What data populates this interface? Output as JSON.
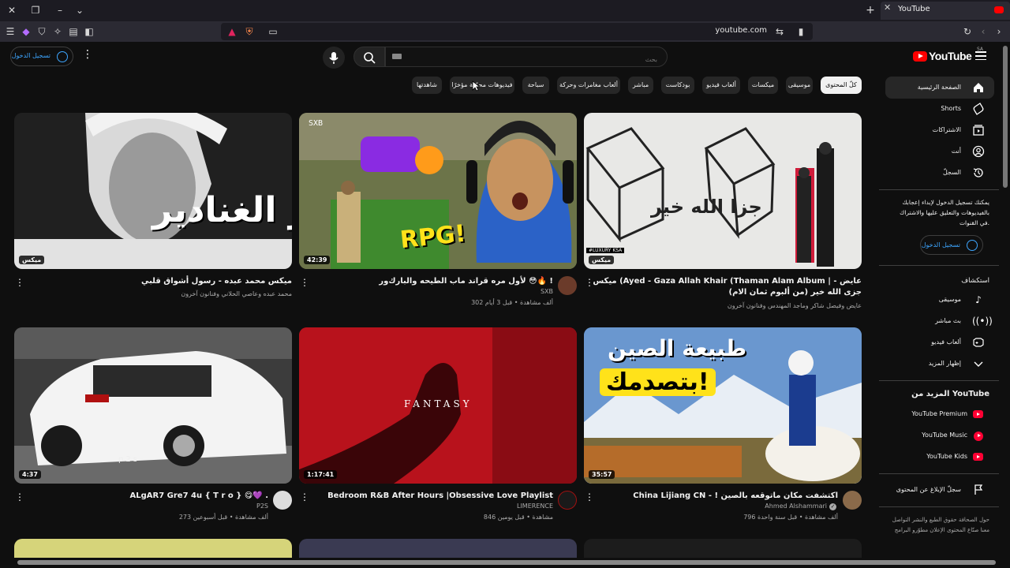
{
  "browser": {
    "tab_title": "YouTube",
    "url": "youtube.com"
  },
  "masthead": {
    "signin_label": "تسجيل الدخول",
    "search_placeholder": "بحث",
    "logo_text": "YouTube",
    "logo_country": "SA"
  },
  "chips": [
    {
      "label": "كلّ المحتوى",
      "active": true
    },
    {
      "label": "موسيقى"
    },
    {
      "label": "ميكسات"
    },
    {
      "label": "ألعاب فيديو"
    },
    {
      "label": "بودكاست"
    },
    {
      "label": "مباشر"
    },
    {
      "label": "ألعاب مغامرات وحركة"
    },
    {
      "label": "سباحة"
    },
    {
      "label": "فيديوهات محمّلة مؤخرًا"
    },
    {
      "label": "شاهدتها"
    }
  ],
  "guide": {
    "main": [
      {
        "label": "الصفحة الرئيسية",
        "icon": "home-icon"
      },
      {
        "label": "Shorts",
        "icon": "shorts-icon"
      },
      {
        "label": "الاشتراكات",
        "icon": "subscriptions-icon"
      },
      {
        "label": "أنت",
        "icon": "you-icon"
      },
      {
        "label": "السجلّ",
        "icon": "history-icon"
      }
    ],
    "signin_prompt": "يمكنك تسجيل الدخول لإبداء إعجابك بالفيديوهات والتعليق عليها والاشتراك في القنوات.",
    "signin_label": "تسجيل الدخول",
    "explore_heading": "استكشاف",
    "explore": [
      {
        "label": "موسيقى",
        "icon": "music-icon"
      },
      {
        "label": "بث مباشر",
        "icon": "live-icon"
      },
      {
        "label": "ألعاب فيديو",
        "icon": "gaming-icon"
      },
      {
        "label": "إظهار المزيد",
        "icon": "chevron-down-icon"
      }
    ],
    "more_heading": "المزيد من YouTube",
    "more": [
      {
        "label": "YouTube Premium"
      },
      {
        "label": "YouTube Music"
      },
      {
        "label": "YouTube Kids"
      }
    ],
    "report_label": "سجلّ الإبلاغ عن المحتوى",
    "footer": "حول  الصحافة  حقوق الطبع والنشر  التواصل معنا  صنّاع المحتوى  الإعلان  مطوّرو البرامج"
  },
  "videos": [
    {
      "title": "ميكس محمد عبده - رسول أشواق قلبي",
      "channel": "محمد عبده وعاصي الحلاني وفنانون آخرون",
      "meta": "",
      "duration": "ميكس",
      "thumb_text": "سير الغنادير"
    },
    {
      "title": "لأول مره قراند ماب الطيحه والبارك‌ور 😳🔥 !",
      "channel": "SXB",
      "meta": "302 ألف مشاهدة • قبل 3 أيام",
      "duration": "42:39",
      "thumb_text": "RPG!",
      "thumb_tag": "SXB"
    },
    {
      "title": "ميكس (Ayed - Gaza Allah Khair (Thaman Alam Album | عايض - جزى الله خير (من ألبوم ثمان الام)",
      "channel": "عايض وفيصل شاكر وماجد المهندس وفنانون آخرون",
      "meta": "",
      "duration": "ميكس",
      "thumb_text": "جزا الله خير",
      "thumb_tag": "#LUXURY KSA"
    },
    {
      "title": "ALgAR7 Gre7 4u { T r o } 😋💜 .",
      "channel": "P2S",
      "meta": "273 ألف مشاهدة • قبل أسبوعين",
      "duration": "4:37",
      "thumb_text": "p2s"
    },
    {
      "title": "Bedroom R&B After Hours |Obsessive Love Playlist",
      "channel": "LIMERENCE",
      "meta": "846 مشاهدة • قبل يومين",
      "duration": "1:17:41",
      "thumb_text": "FANTASY"
    },
    {
      "title": "China Lijiang CN - ! اكتشفت مكان ماتوقعه بالصين",
      "channel": "Ahmed Alshammari",
      "meta": "796 ألف مشاهدة • قبل سنة واحدة",
      "duration": "35:57",
      "thumb_text": "طبيعة الصين",
      "thumb_text2": "بتصدمك!"
    }
  ],
  "colors": {
    "accent": "#3ea6ff",
    "brand": "#ff0000",
    "background": "#0f0f0f"
  }
}
